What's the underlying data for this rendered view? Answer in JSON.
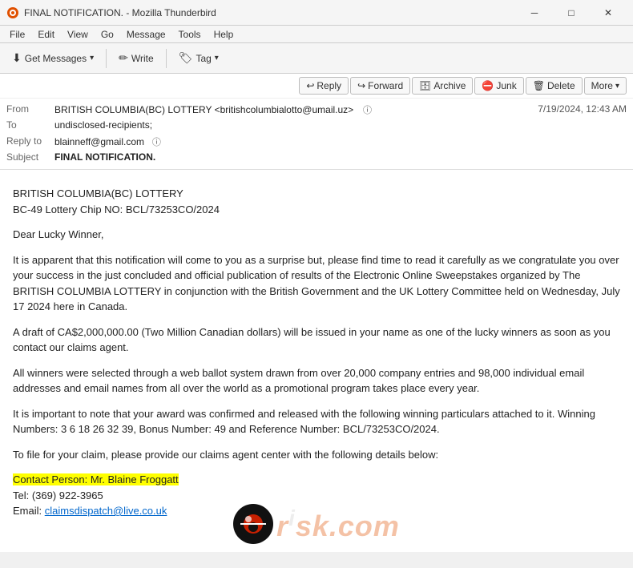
{
  "window": {
    "title": "FINAL NOTIFICATION. - Mozilla Thunderbird",
    "icon": "🦅"
  },
  "titlebar": {
    "title": "FINAL NOTIFICATION. - Mozilla Thunderbird",
    "minimize_label": "─",
    "maximize_label": "□",
    "close_label": "✕"
  },
  "menubar": {
    "items": [
      "File",
      "Edit",
      "View",
      "Go",
      "Message",
      "Tools",
      "Help"
    ]
  },
  "toolbar": {
    "get_messages_label": "Get Messages",
    "write_label": "Write",
    "tag_label": "Tag"
  },
  "actions": {
    "reply_label": "Reply",
    "forward_label": "Forward",
    "archive_label": "Archive",
    "junk_label": "Junk",
    "delete_label": "Delete",
    "more_label": "More"
  },
  "email": {
    "from_label": "From",
    "from_value": "BRITISH COLUMBIA(BC) LOTTERY <britishcolumbialotto@umail.uz>",
    "to_label": "To",
    "to_value": "undisclosed-recipients;",
    "reply_to_label": "Reply to",
    "reply_to_value": "blainneff@gmail.com",
    "subject_label": "Subject",
    "subject_value": "FINAL NOTIFICATION.",
    "date": "7/19/2024, 12:43 AM"
  },
  "body": {
    "line1": "BRITISH COLUMBIA(BC) LOTTERY",
    "line2": "BC-49 Lottery Chip NO: BCL/73253CO/2024",
    "para1": "Dear Lucky Winner,",
    "para2": "It is apparent that this notification will come to you as a surprise but, please find time to read it carefully as we congratulate you over your success in the just concluded and official publication of results of the Electronic Online Sweepstakes organized by The BRITISH COLUMBIA LOTTERY in conjunction with the British Government and the UK Lottery Committee held on Wednesday, July 17 2024 here in Canada.",
    "para3": "A draft of CA$2,000,000.00 (Two Million Canadian dollars) will be issued in your name as one of the lucky winners as soon as you contact our claims agent.",
    "para4": "All winners were selected through a web ballot system drawn from over 20,000 company entries and 98,000 individual email addresses and email names from all over the world as a promotional program takes place every year.",
    "para5": "It is important to note that your award was confirmed and released with the following winning particulars attached to it. Winning Numbers: 3 6 18 26 32 39, Bonus Number: 49 and Reference Number: BCL/73253CO/2024.",
    "para6": "To file for your claim, please provide our claims agent center with the following details below:",
    "contact1": "Contact Person: Mr. Blaine Froggatt",
    "contact2": "Tel: (369) 922-3965",
    "contact3_pre": "Email: ",
    "contact3_link": "claimsdispatch@live.co.uk"
  },
  "watermark": {
    "text": "risk.com"
  }
}
